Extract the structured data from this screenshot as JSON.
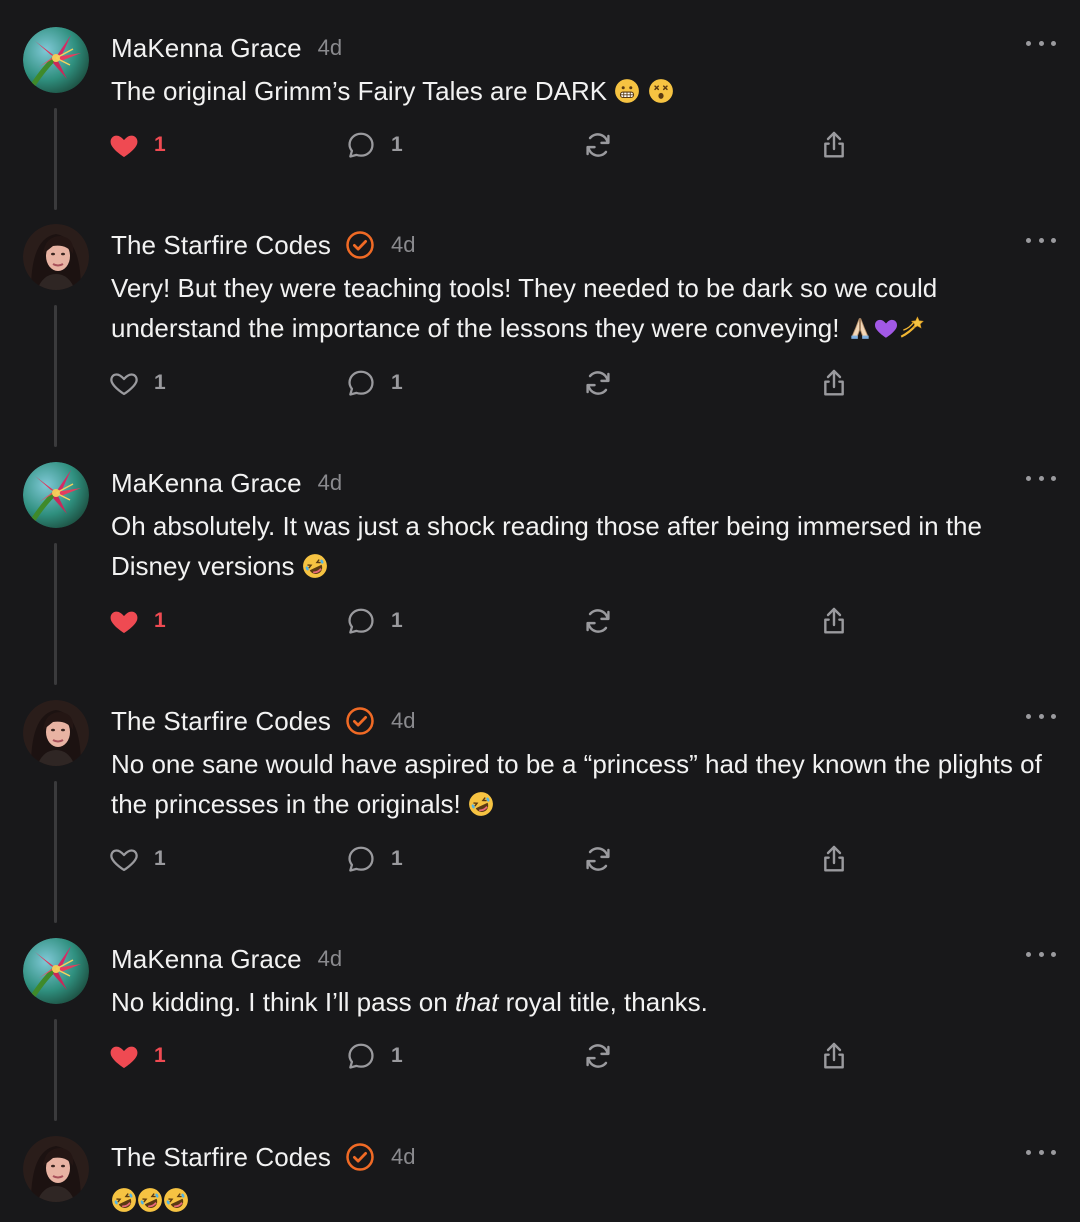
{
  "posts": [
    {
      "author": "MaKenna Grace",
      "time": "4d",
      "verified": false,
      "avatar": "flower-avatar",
      "text_parts": [
        "The original Grimm’s Fairy Tales are DARK "
      ],
      "emojis": [
        "grimacing-face-emoji",
        "dizzy-face-emoji"
      ],
      "liked": true,
      "likes": "1",
      "replies": "1"
    },
    {
      "author": "The Starfire Codes",
      "time": "4d",
      "verified": true,
      "avatar": "woman-portrait-avatar",
      "text_parts": [
        "Very! But they were teaching tools! They needed to be dark so we could understand the importance of the lessons they were conveying! "
      ],
      "emojis": [
        "folded-hands-emoji",
        "purple-heart-emoji",
        "dizzy-star-emoji"
      ],
      "liked": false,
      "likes": "1",
      "replies": "1"
    },
    {
      "author": "MaKenna Grace",
      "time": "4d",
      "verified": false,
      "avatar": "flower-avatar",
      "text_parts": [
        "Oh absolutely. It was just a shock reading those after being immersed in the Disney versions "
      ],
      "emojis": [
        "rofl-emoji"
      ],
      "liked": true,
      "likes": "1",
      "replies": "1"
    },
    {
      "author": "The Starfire Codes",
      "time": "4d",
      "verified": true,
      "avatar": "woman-portrait-avatar",
      "text_parts": [
        "No one sane would have aspired to be a “princess” had they known the plights of the princesses in the originals! "
      ],
      "emojis": [
        "rofl-emoji"
      ],
      "liked": false,
      "likes": "1",
      "replies": "1"
    },
    {
      "author": "MaKenna Grace",
      "time": "4d",
      "verified": false,
      "avatar": "flower-avatar",
      "text_parts": [
        "No kidding. I think I’ll pass on ",
        "that",
        " royal title, thanks."
      ],
      "emojis": [],
      "liked": true,
      "likes": "1",
      "replies": "1"
    },
    {
      "author": "The Starfire Codes",
      "time": "4d",
      "verified": true,
      "avatar": "woman-portrait-avatar",
      "text_parts": [
        ""
      ],
      "emojis": [
        "rofl-emoji",
        "rofl-emoji",
        "rofl-emoji"
      ]
    }
  ],
  "colors": {
    "background": "#18181a",
    "like_active": "#ef4a52",
    "verified_badge": "#f06a25",
    "muted": "#9a9a9e",
    "thread_line": "#3a3a3c"
  },
  "icons": {
    "like": "heart-icon",
    "reply": "speech-bubble-icon",
    "repost": "repost-icon",
    "share": "share-icon",
    "more": "more-options-icon",
    "verified": "verified-badge-icon"
  }
}
